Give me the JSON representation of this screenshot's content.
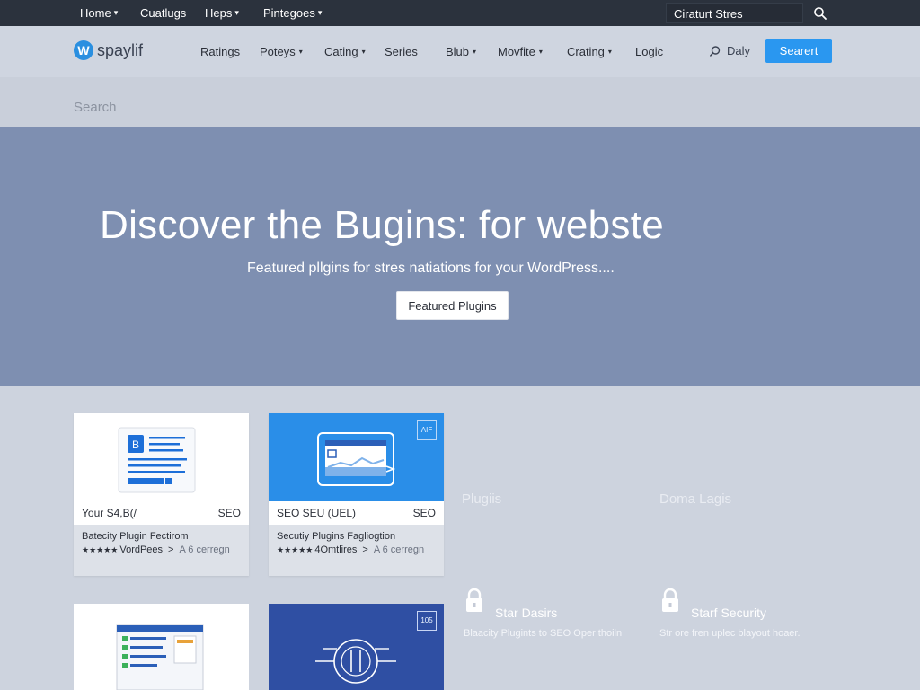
{
  "topbar": {
    "items": [
      {
        "label": "Home",
        "dropdown": true
      },
      {
        "label": "Cuatlugs",
        "dropdown": false
      },
      {
        "label": "Heps",
        "dropdown": true
      },
      {
        "label": "Pintegoes",
        "dropdown": true
      }
    ],
    "search_value": "Ciraturt Stres",
    "search_icon": "search-icon"
  },
  "brand": {
    "logo_letter": "W",
    "name": "spaylif"
  },
  "mainnav": {
    "items": [
      {
        "label": "Ratings",
        "dropdown": false
      },
      {
        "label": "Poteys",
        "dropdown": true
      },
      {
        "label": "Cating",
        "dropdown": true
      },
      {
        "label": "Series",
        "dropdown": false
      },
      {
        "label": "Blub",
        "dropdown": true
      },
      {
        "label": "Movfite",
        "dropdown": true
      },
      {
        "label": "Crating",
        "dropdown": true
      },
      {
        "label": "Logic",
        "dropdown": false
      }
    ],
    "daily_label": "Daly",
    "search_button": "Searert"
  },
  "searchbar": {
    "placeholder": "Search"
  },
  "hero": {
    "title": "Discover the Bugins: for webste",
    "subtitle": "Featured pllgins for stres natiations for your WordPress....",
    "cta": "Featured Plugins"
  },
  "cards": [
    {
      "left_label": "Your S4,B(/",
      "right_label": "SEO",
      "title": "Batecity Plugin Fectirom",
      "stars": "★★★★★",
      "rating_text": "VordPees",
      "arrow": ">",
      "extra": "A 6 cerregn",
      "thumb": "document-icon"
    },
    {
      "left_label": "SEO SEU (UEL)",
      "right_label": "SEO",
      "title": "Secutiy Plugins Fagliogtion",
      "stars": "★★★★★",
      "rating_text": "4Omtlires",
      "arrow": ">",
      "extra": "A 6 cerregn",
      "badge": "ΛIF",
      "thumb": "browser-window-icon"
    }
  ],
  "small_cards": [
    {
      "thumb": "dashboard-screenshot-icon"
    },
    {
      "badge": "105",
      "thumb": "circuit-logo-icon"
    }
  ],
  "ghost_labels": [
    "Plugiis",
    "Doma Lagis"
  ],
  "features": [
    {
      "title": "Star Dasirs",
      "desc": "Blaacity Plugints to SEO Oper thoiln",
      "icon": "lock-icon"
    },
    {
      "title": "Starf Security",
      "desc": "Str ore fren uplec blayout hoaer.",
      "icon": "lock-icon"
    }
  ],
  "colors": {
    "accent": "#2a97f0",
    "hero_bg": "#7e8fb1",
    "topbar_bg": "#2b323d"
  }
}
